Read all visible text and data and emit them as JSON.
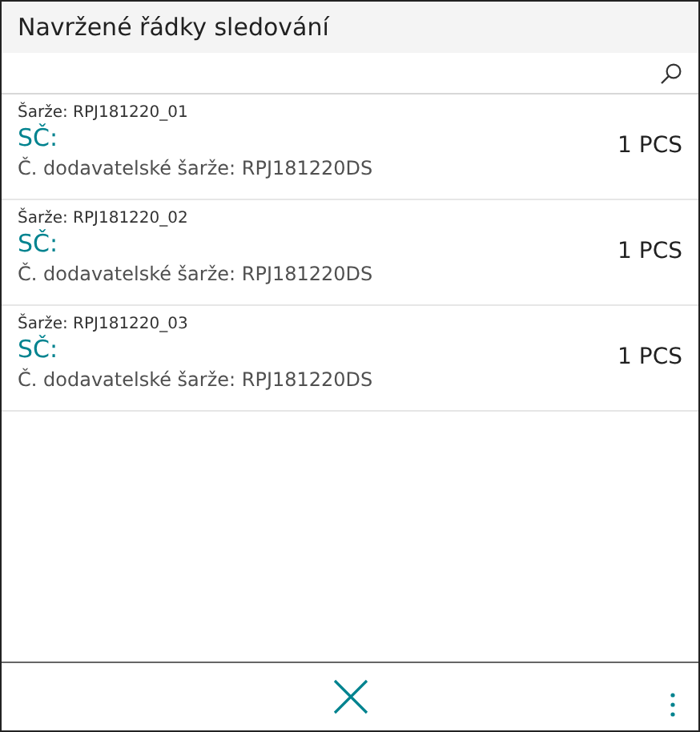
{
  "title": "Navržené řádky sledování",
  "rows": [
    {
      "lot": "Šarže: RPJ181220_01",
      "serial": "SČ:",
      "vendor_lot": "Č. dodavatelské šarže: RPJ181220DS",
      "quantity": "1 PCS"
    },
    {
      "lot": "Šarže: RPJ181220_02",
      "serial": "SČ:",
      "vendor_lot": "Č. dodavatelské šarže: RPJ181220DS",
      "quantity": "1 PCS"
    },
    {
      "lot": "Šarže: RPJ181220_03",
      "serial": "SČ:",
      "vendor_lot": "Č. dodavatelské šarže: RPJ181220DS",
      "quantity": "1 PCS"
    }
  ]
}
